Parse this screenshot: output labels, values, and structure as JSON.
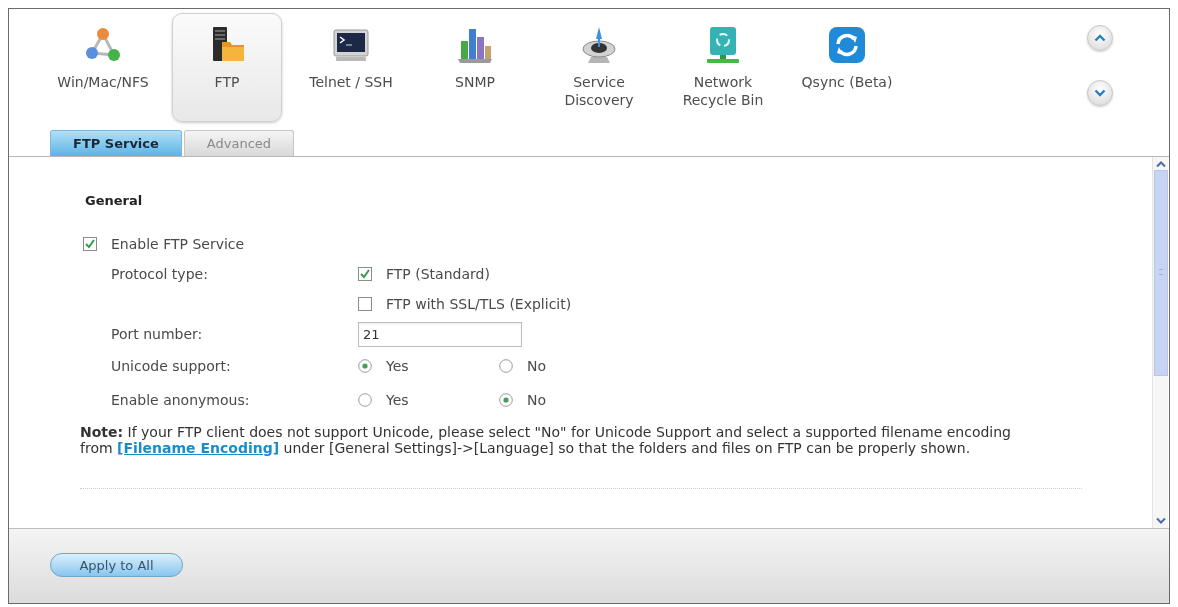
{
  "apps": [
    {
      "label": "Win/Mac/NFS",
      "kind": "nodes",
      "selected": false
    },
    {
      "label": "FTP",
      "kind": "server",
      "selected": true
    },
    {
      "label": "Telnet / SSH",
      "kind": "terminal",
      "selected": false
    },
    {
      "label": "SNMP",
      "kind": "chart",
      "selected": false
    },
    {
      "label": "Service Discovery",
      "kind": "dish",
      "selected": false
    },
    {
      "label": "Network Recycle Bin",
      "kind": "recycle",
      "selected": false
    },
    {
      "label": "Qsync (Beta)",
      "kind": "sync",
      "selected": false
    }
  ],
  "tabs": [
    {
      "label": "FTP Service",
      "selected": true
    },
    {
      "label": "Advanced",
      "selected": false
    }
  ],
  "section": {
    "title": "General",
    "enable": {
      "label": "Enable FTP Service",
      "checked": true
    },
    "fields": [
      {
        "kind": "checkboxes",
        "label": "Protocol type:",
        "options": [
          {
            "label": "FTP (Standard)",
            "checked": true
          },
          {
            "label": "FTP with SSL/TLS (Explicit)",
            "checked": false
          }
        ]
      },
      {
        "kind": "text",
        "label": "Port number:",
        "value": "21"
      },
      {
        "kind": "radio",
        "label": "Unicode support:",
        "options": [
          {
            "label": "Yes",
            "selected": true
          },
          {
            "label": "No",
            "selected": false
          }
        ]
      },
      {
        "kind": "radio",
        "label": "Enable anonymous:",
        "options": [
          {
            "label": "Yes",
            "selected": false
          },
          {
            "label": "No",
            "selected": true
          }
        ]
      }
    ]
  },
  "note": {
    "text": "**Note:** If your FTP client does not support Unicode, please select \"No\" for Unicode Support and select a supported filename encoding from",
    "link": "[Filename Encoding]",
    "text_after": "under [General Settings]->[Language] so that the folders and files on FTP can be properly shown."
  },
  "footer": {
    "button": "Apply to All"
  }
}
